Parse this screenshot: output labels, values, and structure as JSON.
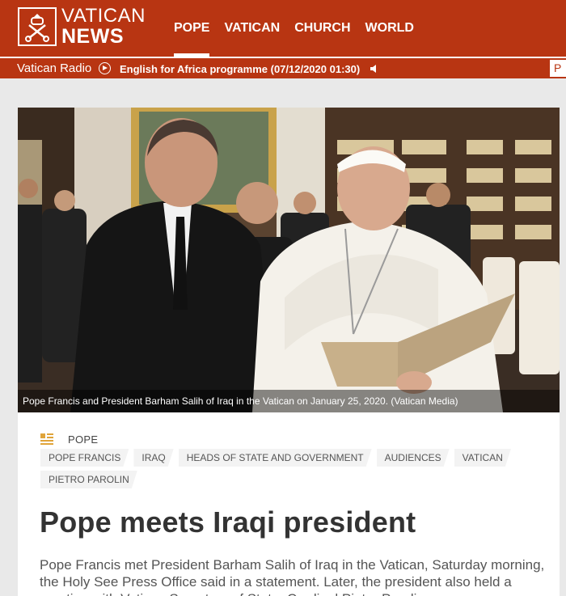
{
  "header": {
    "logo_line1": "VATICAN",
    "logo_line2": "NEWS",
    "nav": [
      {
        "label": "POPE"
      },
      {
        "label": "VATICAN"
      },
      {
        "label": "CHURCH"
      },
      {
        "label": "WORLD"
      }
    ],
    "brand_color": "#b83512"
  },
  "radio": {
    "label": "Vatican Radio",
    "programme": "English for Africa programme (07/12/2020 01:30)",
    "box_text": "P"
  },
  "photo": {
    "caption": "Pope Francis and President Barham Salih of Iraq in the Vatican on January 25, 2020.  (Vatican Media)"
  },
  "article": {
    "section": "POPE",
    "tags": [
      "POPE FRANCIS",
      "IRAQ",
      "HEADS OF STATE AND GOVERNMENT",
      "AUDIENCES",
      "VATICAN",
      "PIETRO PAROLIN"
    ],
    "title": "Pope meets Iraqi president",
    "lead": "Pope Francis met President Barham Salih of Iraq in the Vatican, Saturday morning, the Holy See Press Office said in a statement. Later, the president also held a meeting with Vatican Secretary of State, Cardinal Pietro Parolin."
  }
}
